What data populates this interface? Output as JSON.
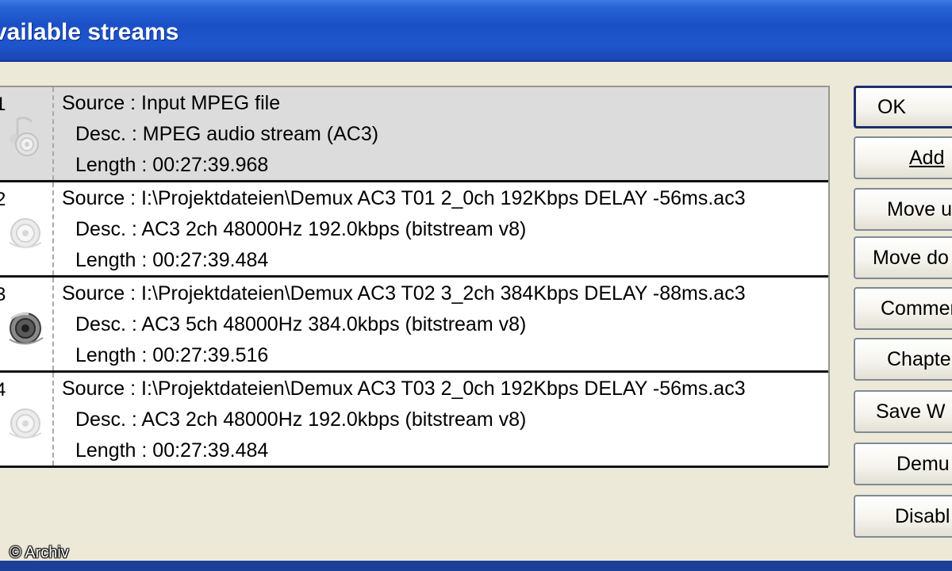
{
  "window": {
    "title": "vailable streams"
  },
  "streams": [
    {
      "number": "1",
      "source": "Source : Input MPEG file",
      "desc": "Desc. : MPEG audio stream (AC3)",
      "length": "Length : 00:27:39.968",
      "icon": "speaker-music-icon",
      "selected": true
    },
    {
      "number": "2",
      "source": "Source : I:\\Projektdateien\\Demux AC3 T01 2_0ch 192Kbps DELAY -56ms.ac3",
      "desc": "Desc. : AC3 2ch 48000Hz 192.0kbps (bitstream v8)",
      "length": "Length : 00:27:39.484",
      "icon": "speaker-faded-icon",
      "selected": false
    },
    {
      "number": "3",
      "source": "Source : I:\\Projektdateien\\Demux AC3 T02 3_2ch 384Kbps DELAY -88ms.ac3",
      "desc": "Desc. : AC3 5ch 48000Hz 384.0kbps (bitstream v8)",
      "length": "Length : 00:27:39.516",
      "icon": "speaker-icon",
      "selected": false
    },
    {
      "number": "4",
      "source": "Source : I:\\Projektdateien\\Demux AC3 T03 2_0ch 192Kbps DELAY -56ms.ac3",
      "desc": "Desc. : AC3 2ch 48000Hz 192.0kbps (bitstream v8)",
      "length": "Length : 00:27:39.484",
      "icon": "speaker-faded-icon",
      "selected": false
    }
  ],
  "buttons": {
    "ok": "OK",
    "add": "Add",
    "move_up": "Move u",
    "move_down": "Move do",
    "comment": "Commen",
    "chapters": "Chapte",
    "save_wav": "Save W",
    "demux": "Demu",
    "disable": "Disabl"
  },
  "copyright": "© Archiv",
  "colors": {
    "titlebar": "#1b4fc6",
    "selected_row": "#dcdcdc",
    "dialog_bg": "#ece9d8"
  }
}
